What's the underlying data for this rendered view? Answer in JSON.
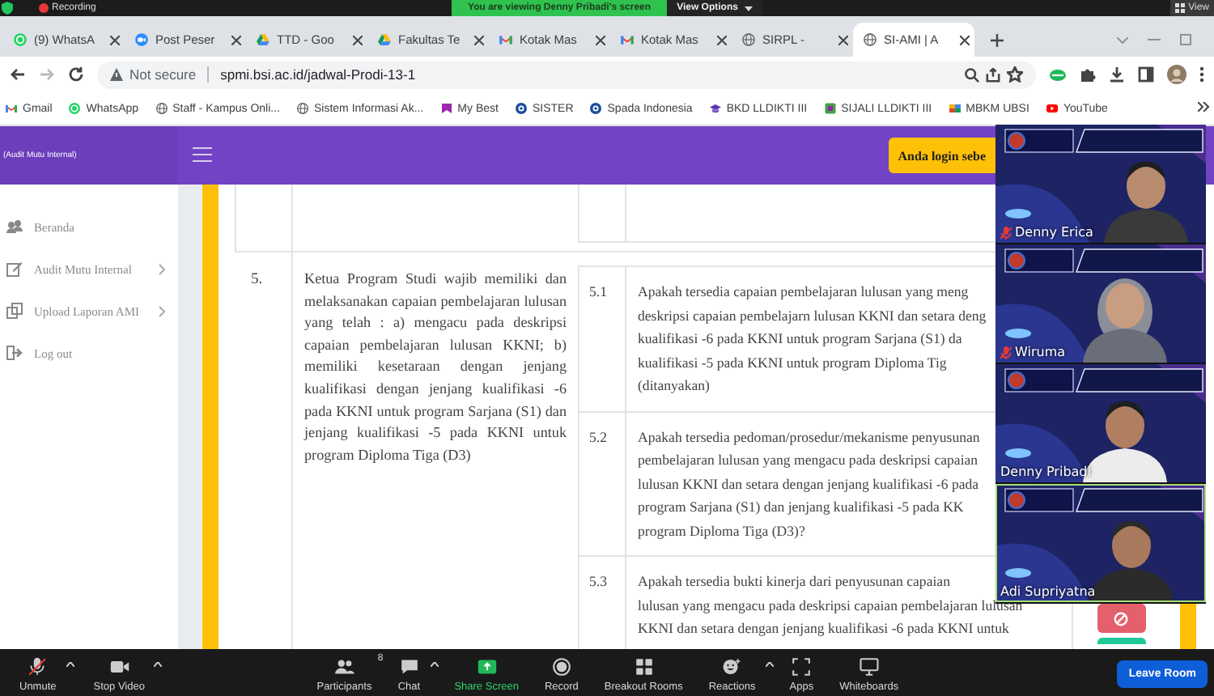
{
  "zoom_top_bar": {
    "recording": "Recording",
    "banner": "You are viewing Denny Pribadi's screen",
    "view_options": "View Options",
    "view": "View"
  },
  "browser": {
    "tabs": [
      {
        "title": "(9) WhatsA",
        "kind": "chat",
        "selected": false
      },
      {
        "title": "Post Peser",
        "kind": "zoom",
        "selected": false
      },
      {
        "title": "TTD - Goo",
        "kind": "drive",
        "selected": false
      },
      {
        "title": "Fakultas Te",
        "kind": "drive",
        "selected": false
      },
      {
        "title": "Kotak Mas",
        "kind": "mail",
        "selected": false
      },
      {
        "title": "Kotak Mas",
        "kind": "mail",
        "selected": false
      },
      {
        "title": "SIRPL -",
        "kind": "globe",
        "selected": false
      },
      {
        "title": "SI-AMI | A",
        "kind": "globe",
        "selected": true
      }
    ],
    "security": "Not secure",
    "url": "spmi.bsi.ac.id/jadwal-Prodi-13-1",
    "bookmarks": [
      {
        "label": "Gmail",
        "kind": "mail"
      },
      {
        "label": "WhatsApp",
        "kind": "chat"
      },
      {
        "label": "Staff - Kampus Onli...",
        "kind": "globe"
      },
      {
        "label": "Sistem Informasi Ak...",
        "kind": "globe"
      },
      {
        "label": "My Best",
        "kind": "bookmark"
      },
      {
        "label": "SISTER",
        "kind": "emblem"
      },
      {
        "label": "Spada Indonesia",
        "kind": "emblem"
      },
      {
        "label": "BKD LLDIKTI III",
        "kind": "cap"
      },
      {
        "label": "SIJALI LLDIKTI III",
        "kind": "app"
      },
      {
        "label": "MBKM UBSI",
        "kind": "tiles"
      },
      {
        "label": "YouTube",
        "kind": "play"
      }
    ]
  },
  "page": {
    "brand": "(Audit Mutu Internal)",
    "login_button": "Anda login sebe",
    "sidebar": {
      "items": [
        {
          "label": "Beranda",
          "kind": "dashboard",
          "has_submenu": false
        },
        {
          "label": "Audit Mutu Internal",
          "kind": "edit",
          "has_submenu": true
        },
        {
          "label": "Upload Laporan AMI",
          "kind": "copy",
          "has_submenu": true
        },
        {
          "label": "Log out",
          "kind": "logout",
          "has_submenu": false
        }
      ]
    },
    "table": {
      "rows": [
        {
          "number": "5.",
          "statement": "Ketua Program Studi wajib memiliki dan melaksanakan capaian pembelajaran lulusan yang telah : a) mengacu pada deskripsi capaian pembelajaran lulusan KKNI; b) memiliki kesetaraan dengan jenjang kualifikasi dengan jenjang kualifikasi -6 pada KKNI untuk program Sarjana (S1) dan jenjang kualifikasi -5 pada KKNI untuk program Diploma Tiga (D3)",
          "questions": [
            {
              "number": "5.1",
              "lines": [
                "Apakah tersedia capaian pembelajaran lulusan yang meng",
                "deskripsi capaian pembelajarn lulusan KKNI dan setara deng",
                "kualifikasi -6 pada KKNI untuk program Sarjana (S1) da",
                "kualifikasi -5 pada KKNI untuk program Diploma Tig",
                "(ditanyakan)"
              ]
            },
            {
              "number": "5.2",
              "lines": [
                "Apakah tersedia pedoman/prosedur/mekanisme penyusunan",
                "pembelajaran lulusan yang mengacu pada deskripsi capaian",
                "lulusan KKNI dan setara dengan jenjang kualifikasi -6 pada",
                "program Sarjana (S1) dan jenjang kualifikasi -5 pada KK",
                "program Diploma Tiga (D3)?"
              ]
            },
            {
              "number": "5.3",
              "lines": [
                "Apakah tersedia bukti kinerja dari penyusunan capaian",
                "lulusan yang mengacu pada deskripsi capaian pembelajaran lulusan",
                "KKNI dan setara dengan jenjang kualifikasi -6 pada KKNI untuk"
              ],
              "actions": [
                {
                  "kind": "danger"
                },
                {
                  "kind": "success"
                }
              ]
            }
          ]
        }
      ]
    }
  },
  "video_tiles": [
    {
      "name": "Denny Erica",
      "muted": true,
      "speaking": false
    },
    {
      "name": "Wiruma",
      "muted": true,
      "speaking": false
    },
    {
      "name": "Denny Pribadi",
      "muted": false,
      "speaking": false
    },
    {
      "name": "Adi Supriyatna",
      "muted": false,
      "speaking": true
    }
  ],
  "zoom_toolbar": {
    "items": [
      {
        "label": "Unmute",
        "kind": "mic_muted",
        "menu": true
      },
      {
        "label": "Stop Video",
        "kind": "video",
        "menu": true
      },
      {
        "label": "Participants",
        "kind": "participants",
        "count": "8",
        "menu": false
      },
      {
        "label": "Chat",
        "kind": "chat",
        "menu": true
      },
      {
        "label": "Share Screen",
        "kind": "share",
        "menu": false
      },
      {
        "label": "Record",
        "kind": "record",
        "menu": false
      },
      {
        "label": "Breakout Rooms",
        "kind": "breakout",
        "menu": false
      },
      {
        "label": "Reactions",
        "kind": "reactions",
        "menu": true
      },
      {
        "label": "Apps",
        "kind": "apps",
        "menu": false
      },
      {
        "label": "Whiteboards",
        "kind": "whiteboard",
        "menu": false
      }
    ],
    "leave": "Leave Room"
  }
}
